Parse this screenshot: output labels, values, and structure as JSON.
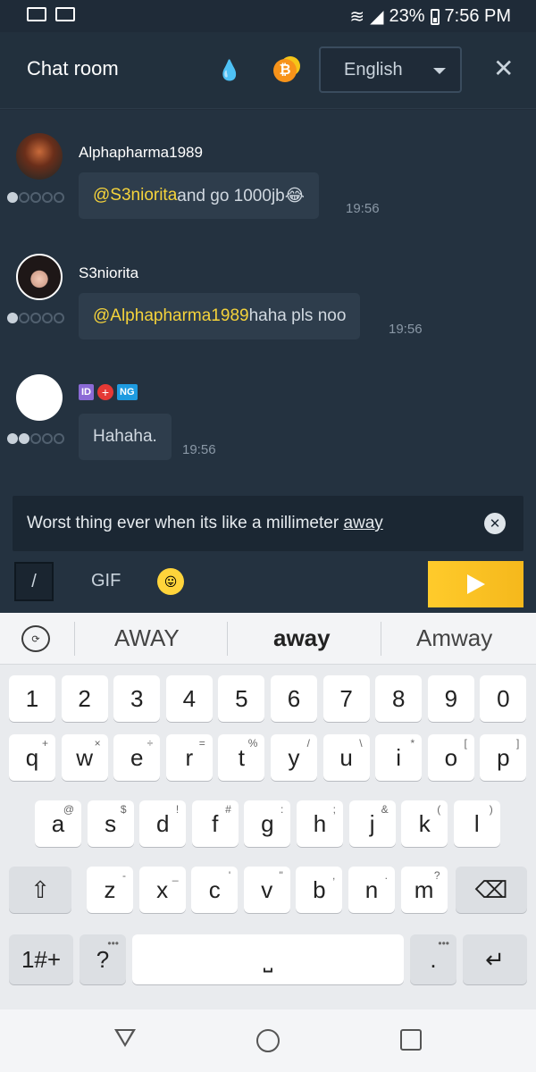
{
  "status_bar": {
    "battery": "23%",
    "time": "7:56 PM"
  },
  "header": {
    "title": "Chat room",
    "language": "English",
    "close_glyph": "✕",
    "coin_glyph": "₿",
    "drops_glyph": "💧"
  },
  "messages": [
    {
      "user": "Alphapharma1989",
      "mention": "@S3niorita",
      "text": " and go 1000jb😂",
      "time": "19:56",
      "rank": 1
    },
    {
      "user": "S3niorita",
      "mention": "@Alphapharma1989",
      "text": " haha pls noo",
      "time": "19:56",
      "rank": 1
    },
    {
      "badges": [
        "ID",
        "+",
        "NG"
      ],
      "text": "Hahaha.",
      "time": "19:56",
      "rank": 2
    }
  ],
  "composer": {
    "text_before": "Worst thing ever when its like a millimeter ",
    "text_underlined": "away",
    "clear_glyph": "✕",
    "slash_label": "/",
    "gif_label": "GIF",
    "emoji": "😛"
  },
  "keyboard": {
    "suggestions": [
      "AWAY",
      "away",
      "Amway"
    ],
    "row_numbers": [
      "1",
      "2",
      "3",
      "4",
      "5",
      "6",
      "7",
      "8",
      "9",
      "0"
    ],
    "row1": [
      {
        "k": "q",
        "h": "+"
      },
      {
        "k": "w",
        "h": "×"
      },
      {
        "k": "e",
        "h": "÷"
      },
      {
        "k": "r",
        "h": "="
      },
      {
        "k": "t",
        "h": "%"
      },
      {
        "k": "y",
        "h": "/"
      },
      {
        "k": "u",
        "h": "\\"
      },
      {
        "k": "i",
        "h": "*"
      },
      {
        "k": "o",
        "h": "["
      },
      {
        "k": "p",
        "h": "]"
      }
    ],
    "row2": [
      {
        "k": "a",
        "h": "@"
      },
      {
        "k": "s",
        "h": "$"
      },
      {
        "k": "d",
        "h": "!"
      },
      {
        "k": "f",
        "h": "#"
      },
      {
        "k": "g",
        "h": ":"
      },
      {
        "k": "h",
        "h": ";"
      },
      {
        "k": "j",
        "h": "&"
      },
      {
        "k": "k",
        "h": "("
      },
      {
        "k": "l",
        "h": ")"
      }
    ],
    "row3": [
      {
        "k": "z",
        "h": "-"
      },
      {
        "k": "x",
        "h": "_"
      },
      {
        "k": "c",
        "h": "'"
      },
      {
        "k": "v",
        "h": "\""
      },
      {
        "k": "b",
        "h": ","
      },
      {
        "k": "n",
        "h": "."
      },
      {
        "k": "m",
        "h": "?"
      }
    ],
    "shift_glyph": "⇧",
    "backspace_glyph": "⌫",
    "symbols_label": "1#+",
    "question_label": "?",
    "space_glyph": "⎵",
    "period_label": ".",
    "enter_glyph": "↵"
  }
}
